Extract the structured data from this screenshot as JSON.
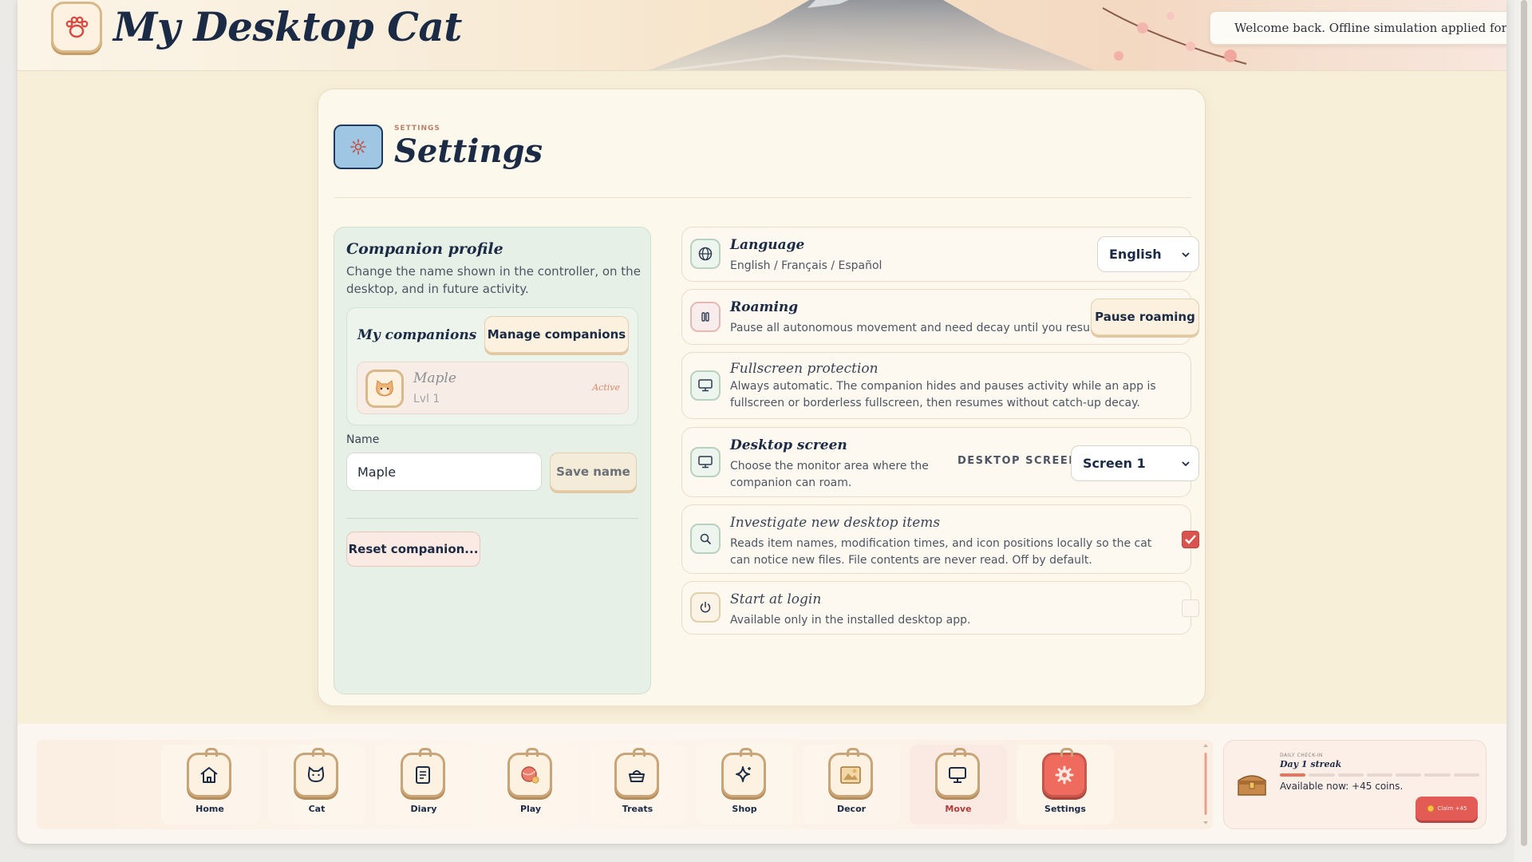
{
  "app": {
    "title": "My Desktop Cat",
    "toast": "Welcome back. Offline simulation applied for th."
  },
  "settings": {
    "eyebrow": "SETTINGS",
    "title": "Settings",
    "profile": {
      "title": "Companion profile",
      "description": "Change the name shown in the controller, on the desktop, and in future activity.",
      "companions_label": "My companions",
      "manage_button": "Manage companions",
      "companion": {
        "name": "Maple",
        "level": "Lvl 1",
        "status": "Active"
      },
      "name_label": "Name",
      "name_value": "Maple",
      "save_button": "Save name",
      "reset_button": "Reset companion..."
    },
    "rows": {
      "language": {
        "title": "Language",
        "description": "English / Français / Español",
        "selected": "English",
        "icon": "globe-icon"
      },
      "roaming": {
        "title": "Roaming",
        "description": "Pause all autonomous movement and need decay until you resume.",
        "button": "Pause roaming",
        "icon": "pause-icon"
      },
      "fullscreen": {
        "title": "Fullscreen protection",
        "description": "Always automatic. The companion hides and pauses activity while an app is fullscreen or borderless fullscreen, then resumes without catch-up decay.",
        "icon": "monitor-icon"
      },
      "desktop_screen": {
        "title": "Desktop screen",
        "description": "Choose the monitor area where the companion can roam.",
        "select_label": "DESKTOP SCREEN",
        "selected": "Screen 1",
        "icon": "monitor-icon"
      },
      "investigate": {
        "title": "Investigate new desktop items",
        "description": "Reads item names, modification times, and icon positions locally so the cat can notice new files. File contents are never read. Off by default.",
        "checked": true,
        "icon": "search-icon"
      },
      "start_login": {
        "title": "Start at login",
        "description": "Available only in the installed desktop app.",
        "checked": false,
        "icon": "power-icon"
      }
    }
  },
  "nav": {
    "items": [
      {
        "label": "Home",
        "icon": "home-icon"
      },
      {
        "label": "Cat",
        "icon": "cat-icon"
      },
      {
        "label": "Diary",
        "icon": "diary-icon"
      },
      {
        "label": "Play",
        "icon": "ball-icon"
      },
      {
        "label": "Treats",
        "icon": "treat-bowl-icon"
      },
      {
        "label": "Shop",
        "icon": "sparkle-icon"
      },
      {
        "label": "Decor",
        "icon": "picture-frame-icon"
      },
      {
        "label": "Move",
        "icon": "monitor-icon"
      },
      {
        "label": "Settings",
        "icon": "gear-icon"
      }
    ],
    "active": "Move",
    "selected": "Settings"
  },
  "checkin": {
    "eyebrow": "DAILY CHECK-IN",
    "title": "Day 1 streak",
    "streak_days_completed": 1,
    "streak_days_total": 7,
    "text": "Available now: +45 coins.",
    "claim_button": "Claim +45"
  },
  "colors": {
    "accent_red": "#e25c55",
    "title_navy": "#1b2a45",
    "profile_green": "#e6f0e6",
    "checkbox_checked": "#d9534f"
  }
}
